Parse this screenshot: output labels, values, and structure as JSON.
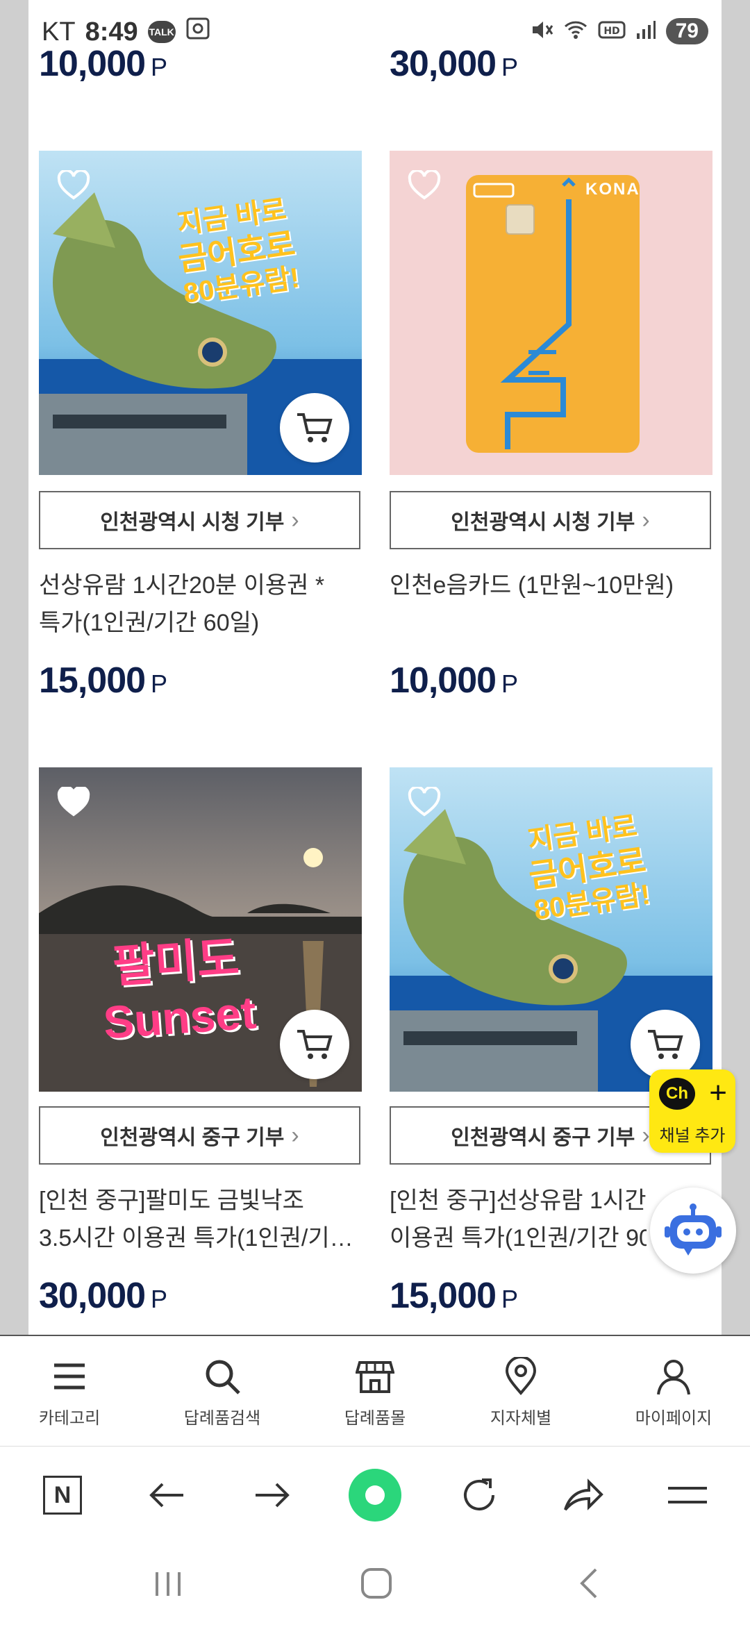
{
  "status_bar": {
    "carrier": "KT",
    "time": "8:49",
    "talk_badge": "TALK",
    "battery": "79"
  },
  "top_prices": [
    {
      "amount": "10,000",
      "unit": "P"
    },
    {
      "amount": "30,000",
      "unit": "P"
    }
  ],
  "products": [
    {
      "image_text": [
        "지금 바로",
        "금어호로",
        "80분유람!"
      ],
      "donate": "인천광역시 시청 기부",
      "title_lines": [
        "선상유람 1시간20분 이용권 *",
        "특가(1인권/기간 60일)"
      ],
      "price": "15,000",
      "unit": "P"
    },
    {
      "image_text": [
        "KONA"
      ],
      "donate": "인천광역시 시청 기부",
      "title_lines": [
        "인천e음카드 (1만원~10만원)",
        ""
      ],
      "price": "10,000",
      "unit": "P"
    },
    {
      "image_text": [
        "팔미도",
        "Sunset"
      ],
      "donate": "인천광역시 중구 기부",
      "title_lines": [
        "[인천 중구]팔미도 금빛낙조",
        "3.5시간 이용권 특가(1인권/기…"
      ],
      "price": "30,000",
      "unit": "P"
    },
    {
      "image_text": [
        "지금 바로",
        "금어호로",
        "80분유람!"
      ],
      "donate": "인천광역시 중구 기부",
      "title_lines": [
        "[인천 중구]선상유람 1시간2",
        "이용권 특가(1인권/기간 90"
      ],
      "price": "15,000",
      "unit": "P"
    }
  ],
  "channel_button": {
    "icon_text": "Ch",
    "label": "채널 추가"
  },
  "bottom_nav": [
    {
      "label": "카테고리",
      "icon": "menu-icon"
    },
    {
      "label": "답례품검색",
      "icon": "search-icon"
    },
    {
      "label": "답례품몰",
      "icon": "store-icon"
    },
    {
      "label": "지자체별",
      "icon": "location-pin-icon"
    },
    {
      "label": "마이페이지",
      "icon": "user-icon"
    }
  ],
  "browser_toolbar": {
    "n_label": "N"
  },
  "colors": {
    "price": "#0f1f4b",
    "accent_green": "#2bd67b",
    "channel_yellow": "#ffe812"
  }
}
